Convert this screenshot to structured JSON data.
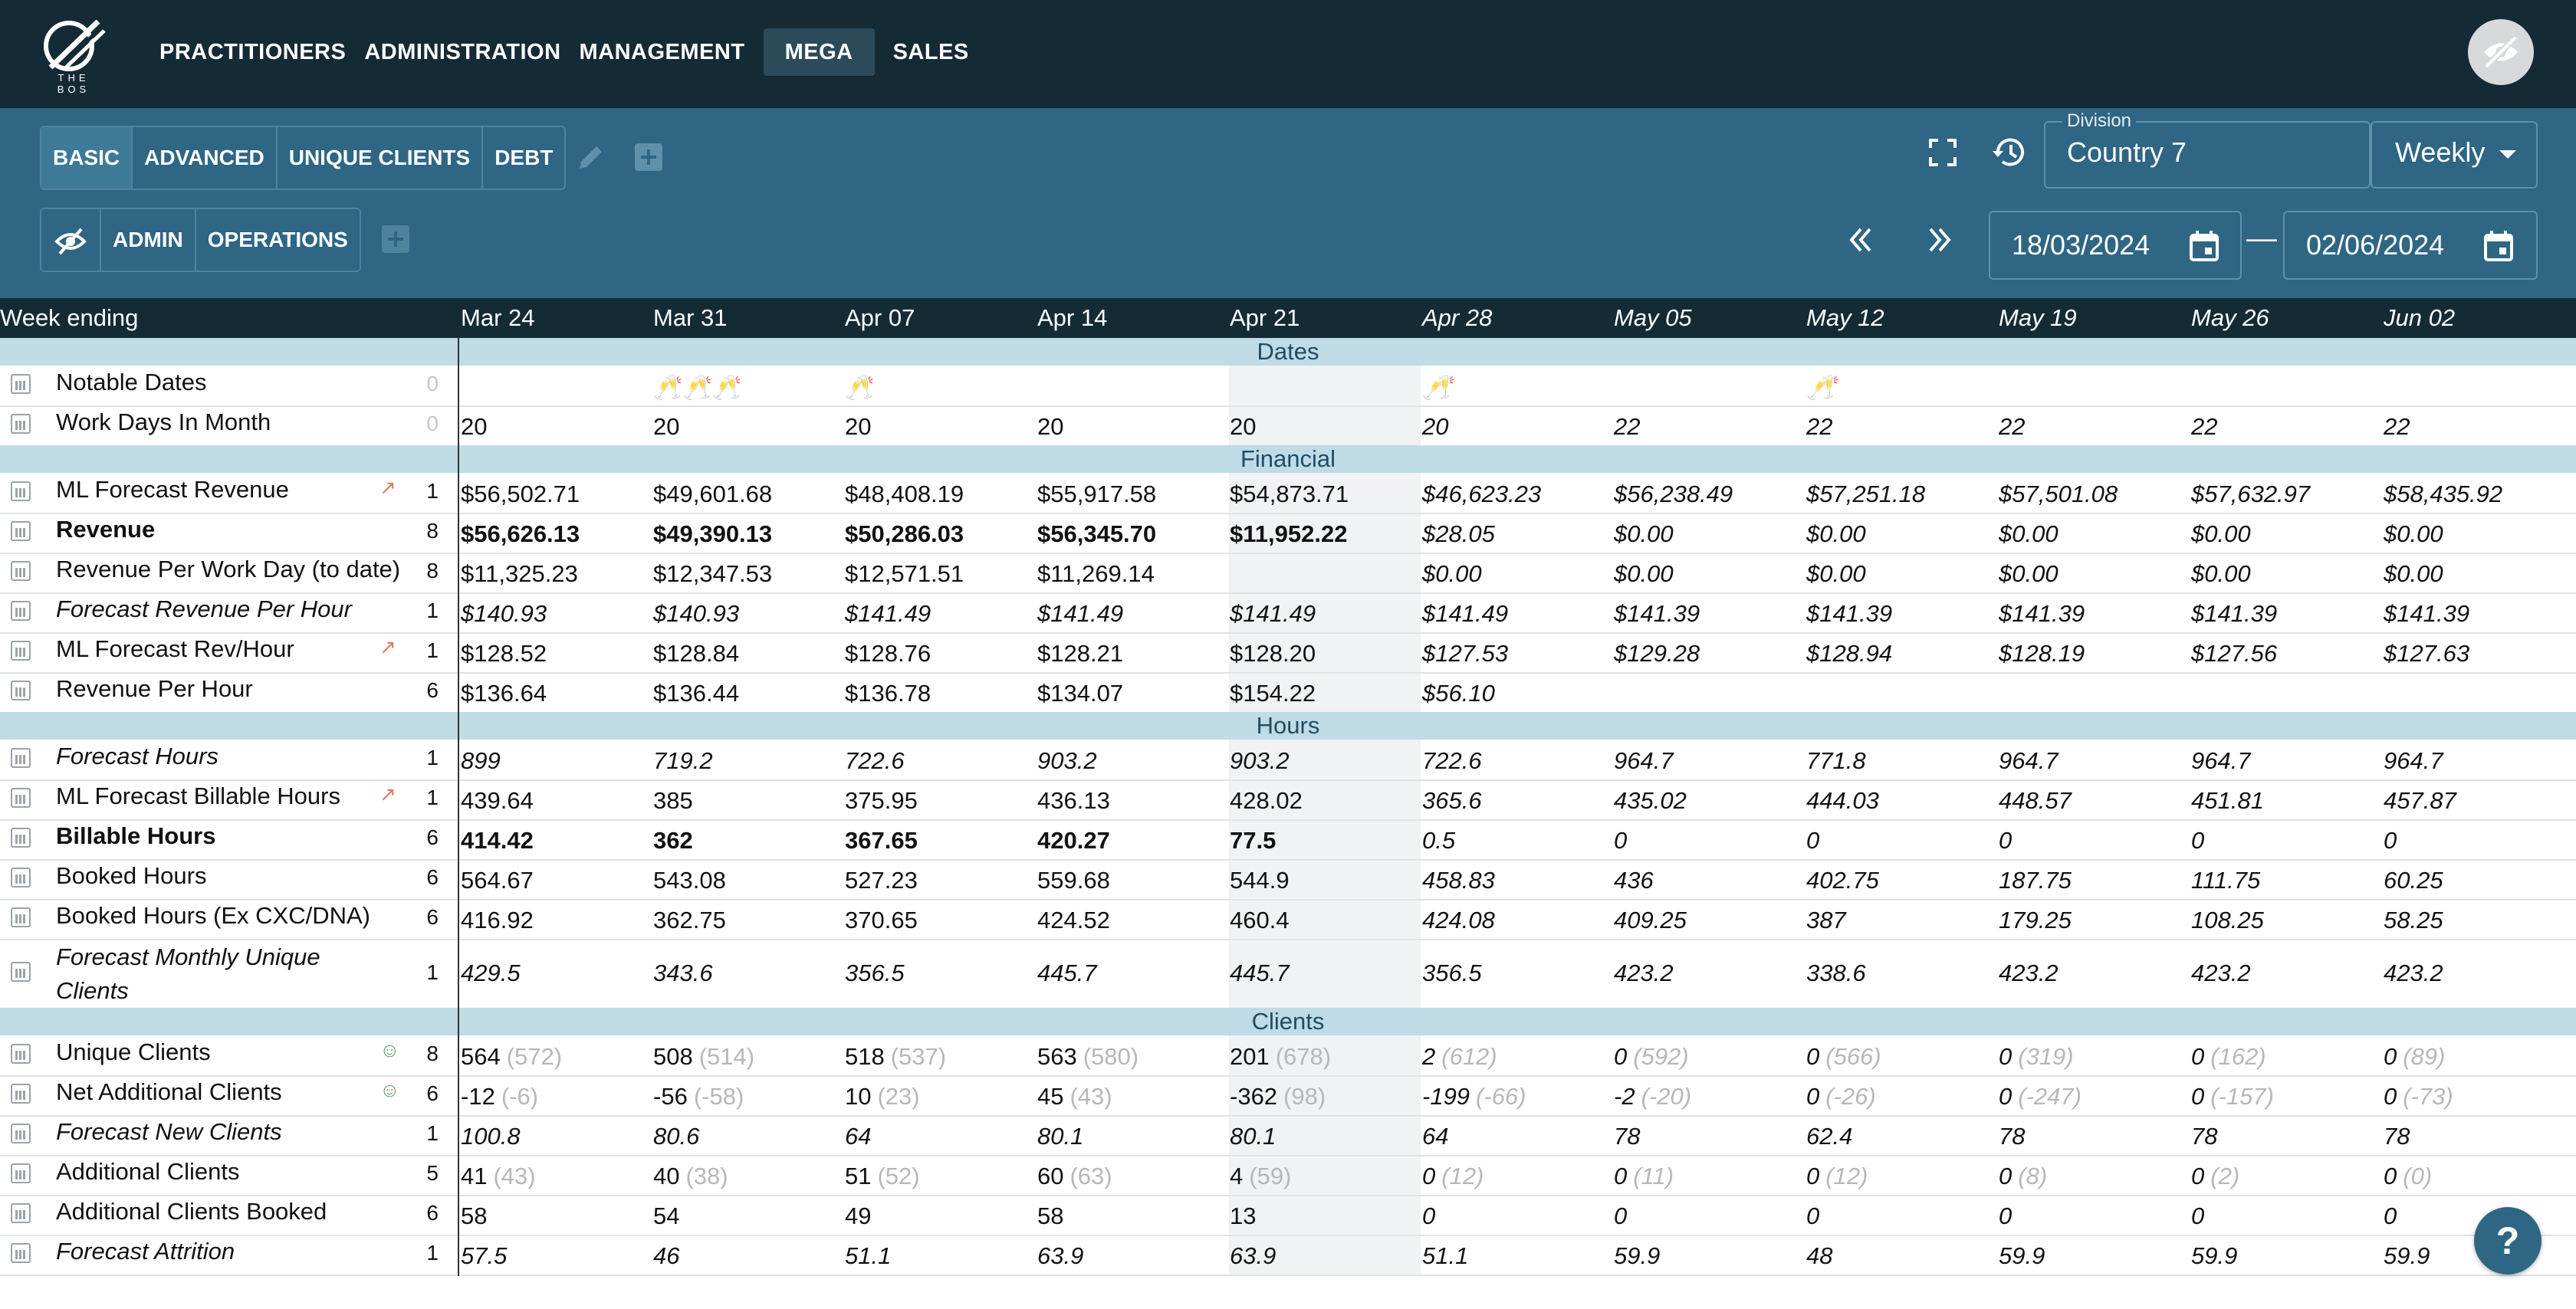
{
  "brand": {
    "logo_text": "THE BOS"
  },
  "nav": [
    "PRACTITIONERS",
    "ADMINISTRATION",
    "MANAGEMENT",
    "MEGA",
    "SALES"
  ],
  "nav_active": "MEGA",
  "toolbar": {
    "view_tabs": [
      "BASIC",
      "ADVANCED",
      "UNIQUE CLIENTS",
      "DEBT"
    ],
    "view_tabs_selected": "BASIC",
    "role_tabs": [
      "ADMIN",
      "OPERATIONS"
    ],
    "division_label": "Division",
    "division_value": "Country 7",
    "period_value": "Weekly",
    "date_start": "18/03/2024",
    "date_end": "02/06/2024",
    "date_separator": "—"
  },
  "table": {
    "header_label": "Week ending",
    "columns": [
      "Mar 24",
      "Mar 31",
      "Apr 07",
      "Apr 14",
      "Apr 21",
      "Apr 28",
      "May 05",
      "May 12",
      "May 19",
      "May 26",
      "Jun 02"
    ],
    "sections": {
      "dates": "Dates",
      "financial": "Financial",
      "hours": "Hours",
      "clients": "Clients"
    },
    "rows": [
      {
        "name": "Notable Dates",
        "count": "0",
        "values": [
          "",
          "🥂🥂🥂",
          "🥂",
          "",
          "",
          "🥂",
          "",
          "🥂",
          "",
          "",
          ""
        ]
      },
      {
        "name": "Work Days In Month",
        "count": "0",
        "values": [
          "20",
          "20",
          "20",
          "20",
          "20",
          "20",
          "22",
          "22",
          "22",
          "22",
          "22"
        ]
      },
      {
        "name": "ML Forecast Revenue",
        "count": "1",
        "values": [
          "$56,502.71",
          "$49,601.68",
          "$48,408.19",
          "$55,917.58",
          "$54,873.71",
          "$46,623.23",
          "$56,238.49",
          "$57,251.18",
          "$57,501.08",
          "$57,632.97",
          "$58,435.92"
        ]
      },
      {
        "name": "Revenue",
        "count": "8",
        "values": [
          "$56,626.13",
          "$49,390.13",
          "$50,286.03",
          "$56,345.70",
          "$11,952.22",
          "$28.05",
          "$0.00",
          "$0.00",
          "$0.00",
          "$0.00",
          "$0.00"
        ]
      },
      {
        "name": "Revenue Per Work Day (to date)",
        "count": "8",
        "values": [
          "$11,325.23",
          "$12,347.53",
          "$12,571.51",
          "$11,269.14",
          "",
          "$0.00",
          "$0.00",
          "$0.00",
          "$0.00",
          "$0.00",
          "$0.00"
        ]
      },
      {
        "name": "Forecast Revenue Per Hour",
        "count": "1",
        "values": [
          "$140.93",
          "$140.93",
          "$141.49",
          "$141.49",
          "$141.49",
          "$141.49",
          "$141.39",
          "$141.39",
          "$141.39",
          "$141.39",
          "$141.39"
        ]
      },
      {
        "name": "ML Forecast Rev/Hour",
        "count": "1",
        "values": [
          "$128.52",
          "$128.84",
          "$128.76",
          "$128.21",
          "$128.20",
          "$127.53",
          "$129.28",
          "$128.94",
          "$128.19",
          "$127.56",
          "$127.63"
        ]
      },
      {
        "name": "Revenue Per Hour",
        "count": "6",
        "values": [
          "$136.64",
          "$136.44",
          "$136.78",
          "$134.07",
          "$154.22",
          "$56.10",
          "",
          "",
          "",
          "",
          ""
        ]
      },
      {
        "name": "Forecast Hours",
        "count": "1",
        "values": [
          "899",
          "719.2",
          "722.6",
          "903.2",
          "903.2",
          "722.6",
          "964.7",
          "771.8",
          "964.7",
          "964.7",
          "964.7"
        ]
      },
      {
        "name": "ML Forecast Billable Hours",
        "count": "1",
        "values": [
          "439.64",
          "385",
          "375.95",
          "436.13",
          "428.02",
          "365.6",
          "435.02",
          "444.03",
          "448.57",
          "451.81",
          "457.87"
        ]
      },
      {
        "name": "Billable Hours",
        "count": "6",
        "values": [
          "414.42",
          "362",
          "367.65",
          "420.27",
          "77.5",
          "0.5",
          "0",
          "0",
          "0",
          "0",
          "0"
        ]
      },
      {
        "name": "Booked Hours",
        "count": "6",
        "values": [
          "564.67",
          "543.08",
          "527.23",
          "559.68",
          "544.9",
          "458.83",
          "436",
          "402.75",
          "187.75",
          "111.75",
          "60.25"
        ]
      },
      {
        "name": "Booked Hours (Ex CXC/DNA)",
        "count": "6",
        "values": [
          "416.92",
          "362.75",
          "370.65",
          "424.52",
          "460.4",
          "424.08",
          "409.25",
          "387",
          "179.25",
          "108.25",
          "58.25"
        ]
      },
      {
        "name": "Forecast Monthly Unique",
        "name2": "Clients",
        "count": "1",
        "values": [
          "429.5",
          "343.6",
          "356.5",
          "445.7",
          "445.7",
          "356.5",
          "423.2",
          "338.6",
          "423.2",
          "423.2",
          "423.2"
        ]
      },
      {
        "name": "Unique Clients",
        "count": "8",
        "values": [
          "564",
          "508",
          "518",
          "563",
          "201",
          "2",
          "0",
          "0",
          "0",
          "0",
          "0"
        ],
        "secondary": [
          "(572)",
          "(514)",
          "(537)",
          "(580)",
          "(678)",
          "(612)",
          "(592)",
          "(566)",
          "(319)",
          "(162)",
          "(89)"
        ]
      },
      {
        "name": "Net Additional Clients",
        "count": "6",
        "values": [
          "-12",
          "-56",
          "10",
          "45",
          "-362",
          "-199",
          "-2",
          "0",
          "0",
          "0",
          "0"
        ],
        "secondary": [
          "(-6)",
          "(-58)",
          "(23)",
          "(43)",
          "(98)",
          "(-66)",
          "(-20)",
          "(-26)",
          "(-247)",
          "(-157)",
          "(-73)"
        ]
      },
      {
        "name": "Forecast New Clients",
        "count": "1",
        "values": [
          "100.8",
          "80.6",
          "64",
          "80.1",
          "80.1",
          "64",
          "78",
          "62.4",
          "78",
          "78",
          "78"
        ]
      },
      {
        "name": "Additional Clients",
        "count": "5",
        "values": [
          "41",
          "40",
          "51",
          "60",
          "4",
          "0",
          "0",
          "0",
          "0",
          "0",
          "0"
        ],
        "secondary": [
          "(43)",
          "(38)",
          "(52)",
          "(63)",
          "(59)",
          "(12)",
          "(11)",
          "(12)",
          "(8)",
          "(2)",
          "(0)"
        ]
      },
      {
        "name": "Additional Clients Booked",
        "count": "6",
        "values": [
          "58",
          "54",
          "49",
          "58",
          "13",
          "0",
          "0",
          "0",
          "0",
          "0",
          "0"
        ]
      },
      {
        "name": "Forecast Attrition",
        "count": "1",
        "values": [
          "57.5",
          "46",
          "51.1",
          "63.9",
          "63.9",
          "51.1",
          "59.9",
          "48",
          "59.9",
          "59.9",
          "59.9"
        ]
      }
    ]
  },
  "help_label": "?"
}
